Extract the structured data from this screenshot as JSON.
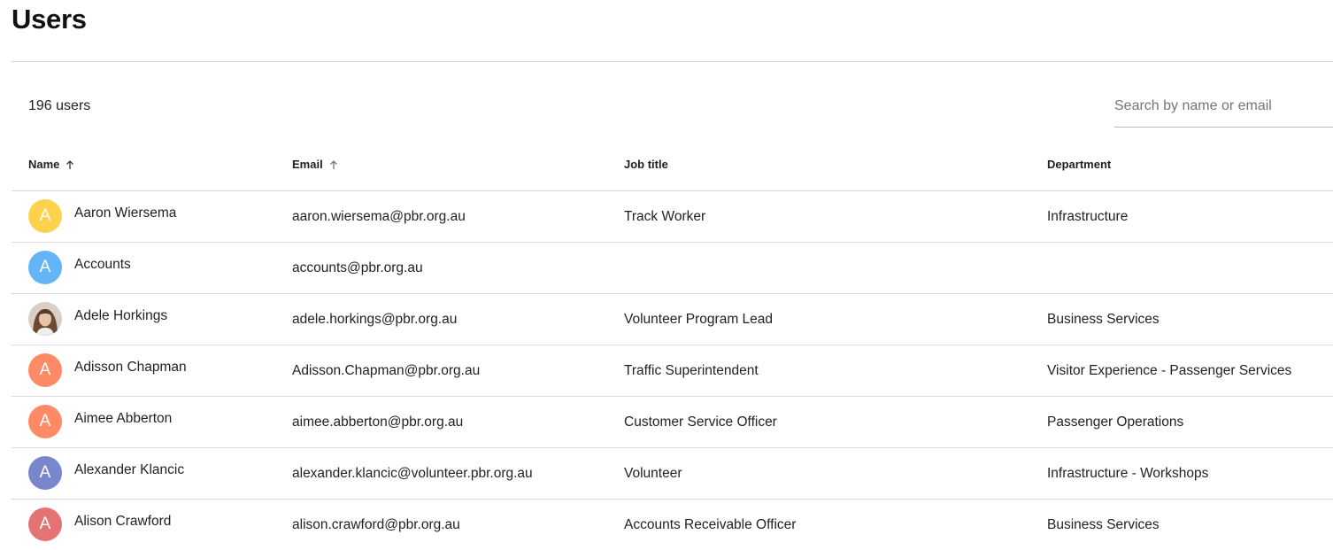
{
  "page": {
    "title": "Users",
    "user_count": "196 users"
  },
  "search": {
    "placeholder": "Search by name or email",
    "value": ""
  },
  "table": {
    "columns": {
      "name": "Name",
      "email": "Email",
      "job_title": "Job title",
      "department": "Department"
    },
    "sort_icon": "arrow-up-icon",
    "rows": [
      {
        "initial": "A",
        "avatar_color": "#FDD34D",
        "avatar_type": "initial",
        "name": "Aaron Wiersema",
        "email": "aaron.wiersema@pbr.org.au",
        "job_title": "Track Worker",
        "department": "Infrastructure"
      },
      {
        "initial": "A",
        "avatar_color": "#64B5F6",
        "avatar_type": "initial",
        "name": "Accounts",
        "email": "accounts@pbr.org.au",
        "job_title": "",
        "department": ""
      },
      {
        "initial": "",
        "avatar_color": "#b89a82",
        "avatar_type": "photo",
        "name": "Adele Horkings",
        "email": "adele.horkings@pbr.org.au",
        "job_title": "Volunteer Program Lead",
        "department": "Business Services"
      },
      {
        "initial": "A",
        "avatar_color": "#FF8A65",
        "avatar_type": "initial",
        "name": "Adisson Chapman",
        "email": "Adisson.Chapman@pbr.org.au",
        "job_title": "Traffic Superintendent",
        "department": "Visitor Experience - Passenger Services"
      },
      {
        "initial": "A",
        "avatar_color": "#FF8A65",
        "avatar_type": "initial",
        "name": "Aimee Abberton",
        "email": "aimee.abberton@pbr.org.au",
        "job_title": "Customer Service Officer",
        "department": "Passenger Operations"
      },
      {
        "initial": "A",
        "avatar_color": "#7986CB",
        "avatar_type": "initial",
        "name": "Alexander Klancic",
        "email": "alexander.klancic@volunteer.pbr.org.au",
        "job_title": "Volunteer",
        "department": "Infrastructure - Workshops"
      },
      {
        "initial": "A",
        "avatar_color": "#E57373",
        "avatar_type": "initial",
        "name": "Alison Crawford",
        "email": "alison.crawford@pbr.org.au",
        "job_title": "Accounts Receivable Officer",
        "department": "Business Services"
      }
    ]
  }
}
